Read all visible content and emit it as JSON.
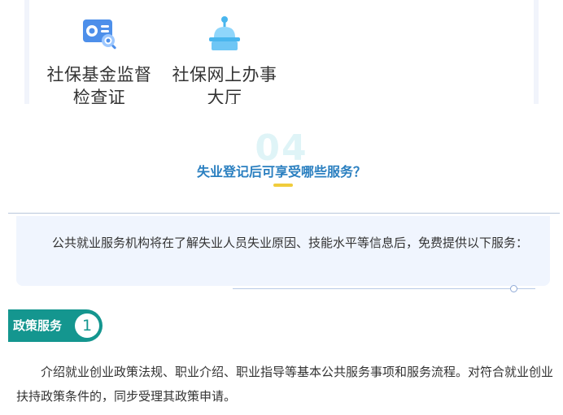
{
  "services": {
    "items": [
      {
        "icon": "supervision-certificate-icon",
        "label": "社保基金监督检查证"
      },
      {
        "icon": "online-service-hall-icon",
        "label": "社保网上办事大厅"
      }
    ]
  },
  "section": {
    "number": "04",
    "title": "失业登记后可享受哪些服务？",
    "intro": "公共就业服务机构将在了解失业人员失业原因、技能水平等信息后，免费提供以下服务："
  },
  "policy": {
    "tag_label": "政策服务",
    "tag_number": "1",
    "text": "介绍就业创业政策法规、职业介绍、职业指导等基本公共服务事项和服务流程。对符合就业创业扶持政策条件的，同步受理其政策申请。"
  },
  "colors": {
    "accent_teal": "#14968f",
    "title_blue": "#2a7fc0",
    "underline_yellow": "#f0cc3c",
    "intro_bg": "#f0f5fe"
  }
}
